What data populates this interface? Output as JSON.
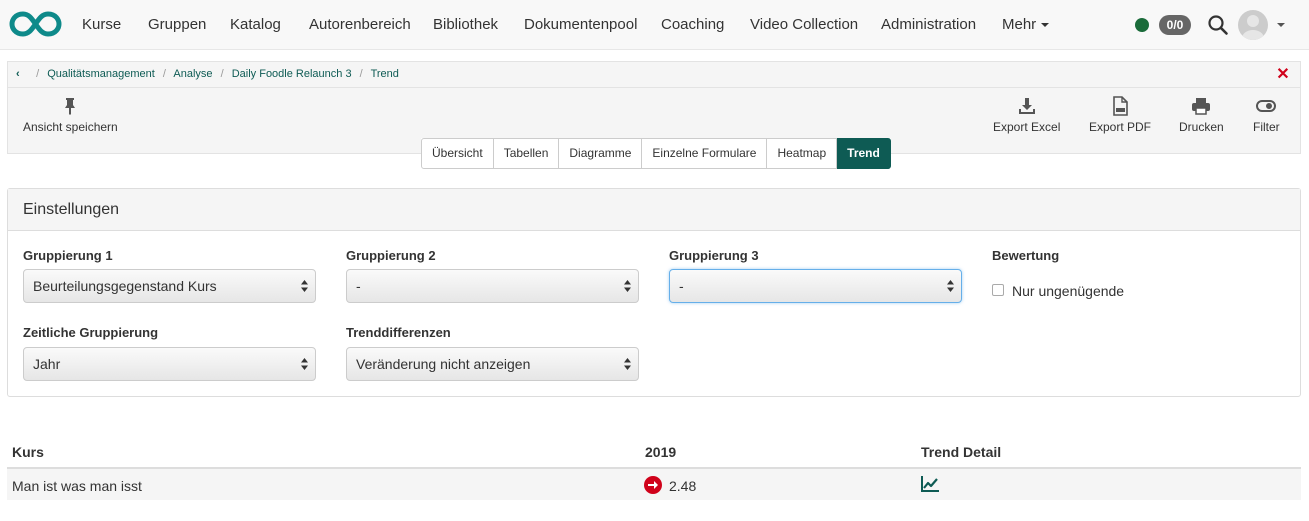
{
  "nav": {
    "items": [
      {
        "label": "Kurse"
      },
      {
        "label": "Gruppen"
      },
      {
        "label": "Katalog"
      },
      {
        "label": "Autorenbereich"
      },
      {
        "label": "Bibliothek"
      },
      {
        "label": "Dokumentenpool"
      },
      {
        "label": "Coaching"
      },
      {
        "label": "Video Collection"
      },
      {
        "label": "Administration"
      },
      {
        "label": "Mehr"
      }
    ],
    "chat_badge": "0/0",
    "status_color": "#1a6b3a",
    "brand_color": "#0e8a8a"
  },
  "breadcrumb": {
    "items": [
      "Qualitätsmanagement",
      "Analyse",
      "Daily Foodle Relaunch 3",
      "Trend"
    ]
  },
  "toolbar": {
    "save_view": "Ansicht speichern",
    "export_excel": "Export Excel",
    "export_pdf": "Export PDF",
    "print": "Drucken",
    "filter": "Filter"
  },
  "tabs": [
    {
      "label": "Übersicht"
    },
    {
      "label": "Tabellen"
    },
    {
      "label": "Diagramme"
    },
    {
      "label": "Einzelne Formulare"
    },
    {
      "label": "Heatmap"
    },
    {
      "label": "Trend",
      "active": true
    }
  ],
  "settings": {
    "title": "Einstellungen",
    "group1": {
      "label": "Gruppierung 1",
      "value": "Beurteilungsgegenstand Kurs"
    },
    "group2": {
      "label": "Gruppierung 2",
      "value": "-"
    },
    "group3": {
      "label": "Gruppierung 3",
      "value": "-"
    },
    "rating": {
      "label": "Bewertung",
      "checkbox_label": "Nur ungenügende",
      "checked": false
    },
    "temporal": {
      "label": "Zeitliche Gruppierung",
      "value": "Jahr"
    },
    "trend_diff": {
      "label": "Trenddifferenzen",
      "value": "Veränderung nicht anzeigen"
    }
  },
  "table": {
    "columns": [
      "Kurs",
      "2019",
      "Trend Detail"
    ],
    "rows": [
      {
        "kurs": "Man ist was man isst",
        "value_2019": "2.48",
        "trend": "down"
      }
    ]
  },
  "colors": {
    "accent": "#0e5b54",
    "danger": "#d0021b"
  }
}
